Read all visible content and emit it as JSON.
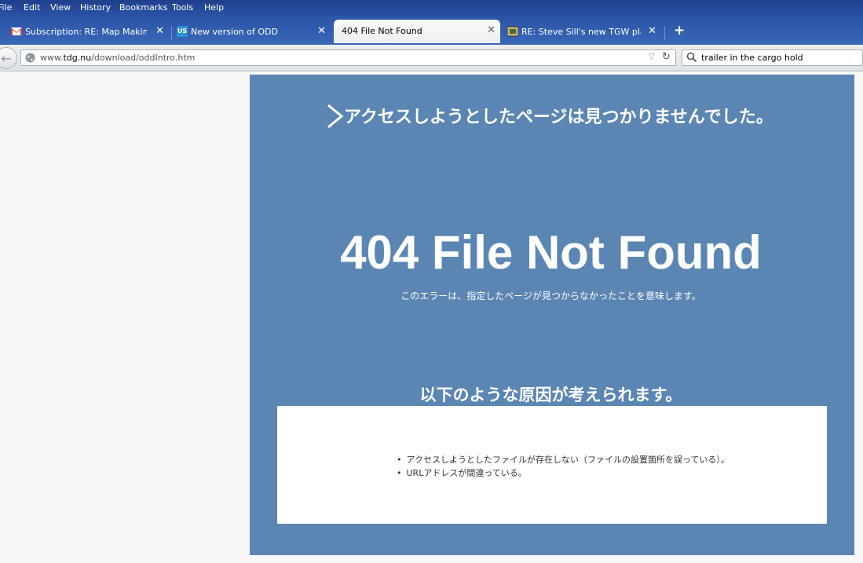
{
  "menu": [
    "File",
    "Edit",
    "View",
    "History",
    "Bookmarks",
    "Tools",
    "Help"
  ],
  "tabs": [
    {
      "label": "Subscription: RE: Map Making...",
      "icon": "gmail-icon",
      "active": false
    },
    {
      "label": "New version of ODD",
      "icon": "site-icon",
      "favicon_text": "US",
      "active": false
    },
    {
      "label": "404 File Not Found",
      "icon": "none",
      "active": true
    },
    {
      "label": "RE: Steve Sill's new TGW play...",
      "icon": "forum-icon",
      "active": false
    }
  ],
  "new_tab_label": "+",
  "url": {
    "prefix": "www.",
    "host": "tdg.nu",
    "path": "/download/oddIntro.htm"
  },
  "search": {
    "value": "trailer in the cargo hold"
  },
  "page": {
    "headline": "アクセスしようとしたページは見つかりませんでした。",
    "big_title": "404 File Not Found",
    "subtext": "このエラーは、指定したページが見つからなかったことを意味します。",
    "causes_heading": "以下のような原因が考えられます。",
    "causes": [
      "アクセスしようとしたファイルが存在しない（ファイルの設置箇所を誤っている）。",
      "URLアドレスが間違っている。"
    ]
  },
  "colors": {
    "panel_bg": "#5b86b4",
    "chrome": "#2b55a8",
    "gmail_red": "#d44638"
  }
}
